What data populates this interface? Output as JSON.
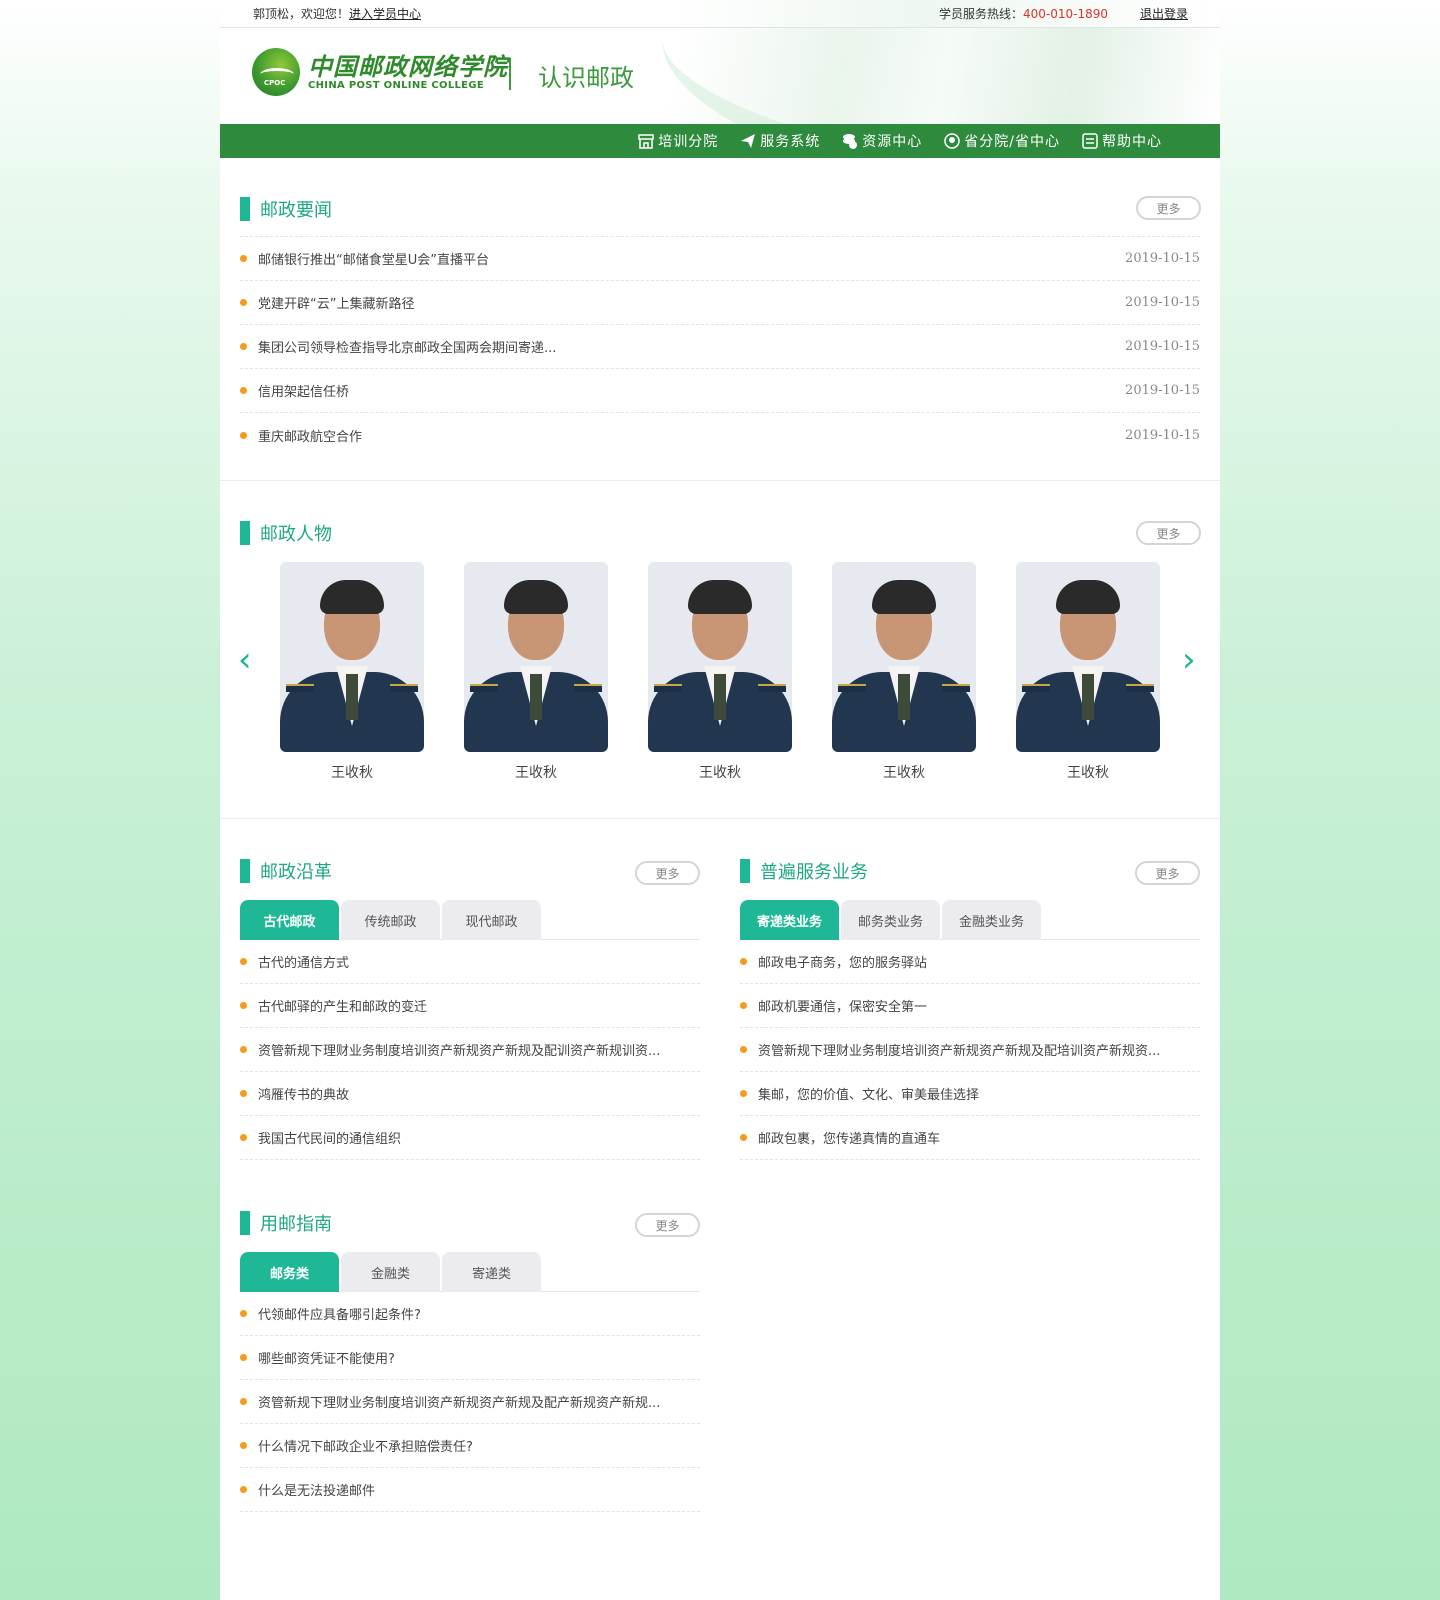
{
  "topbar": {
    "greeting": "郭顶松，欢迎您！",
    "student_center": "进入学员中心",
    "hotline_label": "学员服务热线：",
    "hotline_number": "400-010-1890",
    "logout": "退出登录"
  },
  "header": {
    "logo_cn": "中国邮政网络学院",
    "logo_en": "CHINA POST ONLINE COLLEGE",
    "logo_badge": "CPOC",
    "page_title": "认识邮政"
  },
  "nav": {
    "items": [
      {
        "label": "培训分院",
        "icon": "store-icon"
      },
      {
        "label": "服务系统",
        "icon": "paper-plane-icon"
      },
      {
        "label": "资源中心",
        "icon": "coins-icon"
      },
      {
        "label": "省分院/省中心",
        "icon": "location-icon"
      },
      {
        "label": "帮助中心",
        "icon": "help-icon"
      }
    ]
  },
  "news": {
    "title": "邮政要闻",
    "more": "更多",
    "items": [
      {
        "text": "邮储银行推出“邮储食堂星U会”直播平台",
        "date": "2019-10-15"
      },
      {
        "text": "党建开辟“云”上集藏新路径",
        "date": "2019-10-15"
      },
      {
        "text": "集团公司领导检查指导北京邮政全国两会期间寄递...",
        "date": "2019-10-15"
      },
      {
        "text": "信用架起信任桥",
        "date": "2019-10-15"
      },
      {
        "text": "重庆邮政航空合作",
        "date": "2019-10-15"
      }
    ]
  },
  "people": {
    "title": "邮政人物",
    "more": "更多",
    "prev": "‹",
    "next": "›",
    "items": [
      {
        "name": "王收秋"
      },
      {
        "name": "王收秋"
      },
      {
        "name": "王收秋"
      },
      {
        "name": "王收秋"
      },
      {
        "name": "王收秋"
      }
    ]
  },
  "history": {
    "title": "邮政沿革",
    "more": "更多",
    "tabs": [
      "古代邮政",
      "传统邮政",
      "现代邮政"
    ],
    "items": [
      "古代的通信方式",
      "古代邮驿的产生和邮政的变迁",
      "资管新规下理财业务制度培训资产新规资产新规及配训资产新规训资...",
      "鸿雁传书的典故",
      "我国古代民间的通信组织"
    ]
  },
  "service": {
    "title": "普遍服务业务",
    "more": "更多",
    "tabs": [
      "寄递类业务",
      "邮务类业务",
      "金融类业务"
    ],
    "items": [
      "邮政电子商务，您的服务驿站",
      "邮政机要通信，保密安全第一",
      "资管新规下理财业务制度培训资产新规资产新规及配培训资产新规资...",
      "集邮，您的价值、文化、审美最佳选择",
      "邮政包裹，您传递真情的直通车"
    ]
  },
  "guide": {
    "title": "用邮指南",
    "more": "更多",
    "tabs": [
      "邮务类",
      "金融类",
      "寄递类"
    ],
    "items": [
      "代领邮件应具备哪引起条件?",
      "哪些邮资凭证不能使用?",
      "资管新规下理财业务制度培训资产新规资产新规及配产新规资产新规...",
      "什么情况下邮政企业不承担赔偿责任?",
      "什么是无法投递邮件"
    ]
  },
  "colors": {
    "nav_green": "#2e8b3e",
    "accent_teal": "#1fb896",
    "bullet_orange": "#f59a1a",
    "hotline_red": "#e0322b"
  }
}
